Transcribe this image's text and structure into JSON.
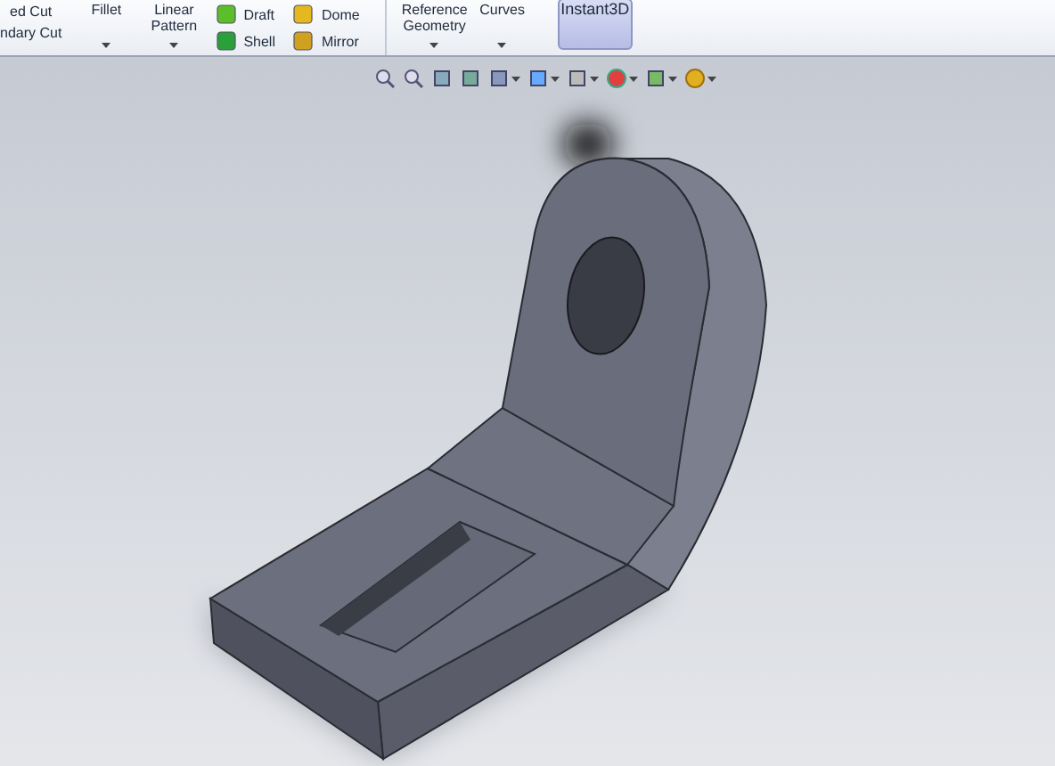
{
  "ribbon": {
    "groups": [
      {
        "kind": "stack",
        "items": [
          {
            "label": "ed Cut"
          },
          {
            "label": "ndary Cut"
          }
        ]
      },
      {
        "kind": "dropdown",
        "label": "Fillet"
      },
      {
        "kind": "dropdown",
        "label": "Linear Pattern"
      },
      {
        "kind": "iconstack",
        "items": [
          {
            "label": "Draft"
          },
          {
            "label": "Shell"
          }
        ]
      },
      {
        "kind": "iconstack",
        "items": [
          {
            "label": "Dome"
          },
          {
            "label": "Mirror"
          }
        ]
      },
      {
        "kind": "divider"
      },
      {
        "kind": "dropdown",
        "label": "Reference Geometry"
      },
      {
        "kind": "dropdown",
        "label": "Curves"
      },
      {
        "kind": "toggle",
        "label": "Instant3D",
        "selected": true
      }
    ]
  }
}
